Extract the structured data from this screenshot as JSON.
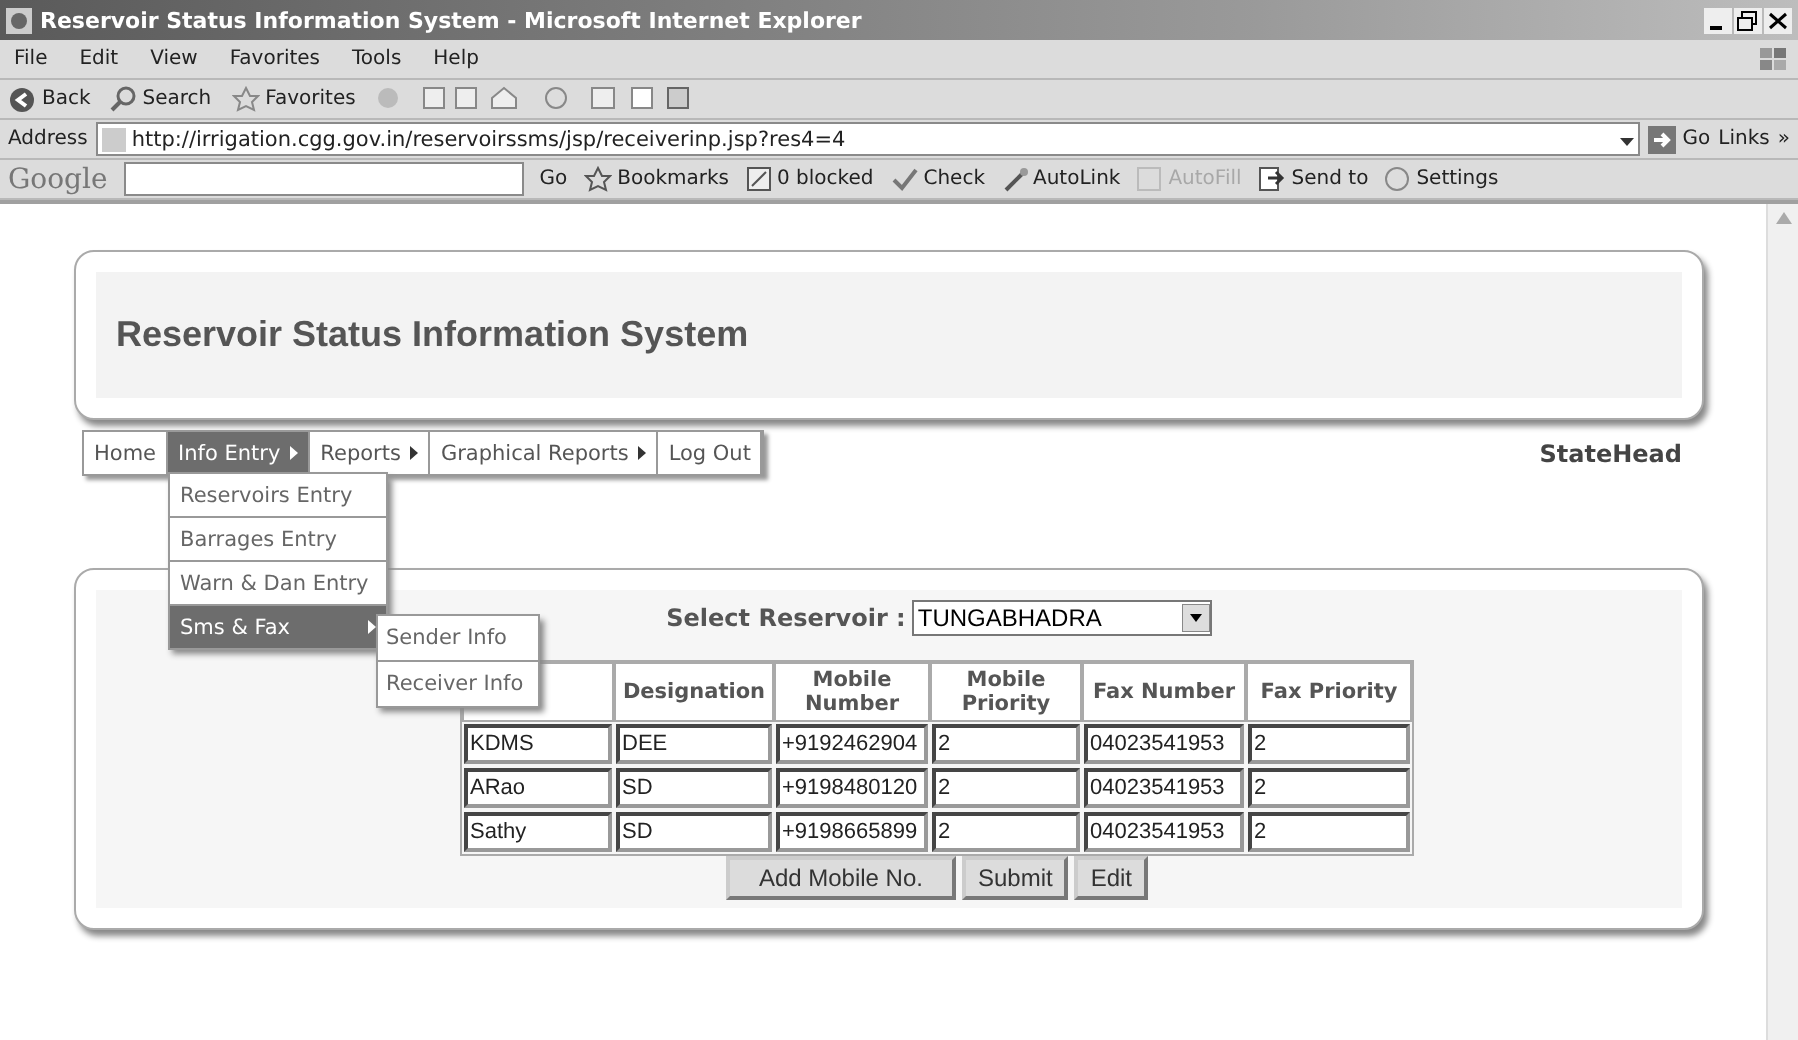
{
  "window": {
    "title": "Reservoir Status Information System - Microsoft Internet Explorer"
  },
  "menu_bar": {
    "items": [
      "File",
      "Edit",
      "View",
      "Favorites",
      "Tools",
      "Help"
    ]
  },
  "toolbar": {
    "buttons": [
      {
        "label": "Back",
        "kind": "back"
      },
      {
        "label": "Search",
        "kind": "search"
      },
      {
        "label": "Favorites",
        "kind": "favorites"
      }
    ]
  },
  "address_bar": {
    "label": "Address",
    "url": "http://irrigation.cgg.gov.in/reservoirssms/jsp/receiverinp.jsp?res4=4",
    "go": "Go",
    "links": "Links",
    "more": "»"
  },
  "google_bar": {
    "logo": "Google",
    "go": "Go",
    "items": [
      {
        "label": "Bookmarks",
        "kind": "star",
        "disabled": false
      },
      {
        "label": "0 blocked",
        "kind": "block",
        "disabled": false
      },
      {
        "label": "Check",
        "kind": "check",
        "disabled": false
      },
      {
        "label": "AutoLink",
        "kind": "wand",
        "disabled": false
      },
      {
        "label": "AutoFill",
        "kind": "form",
        "disabled": true
      },
      {
        "label": "Send to",
        "kind": "send",
        "disabled": false
      },
      {
        "label": "Settings",
        "kind": "settings",
        "disabled": false
      }
    ]
  },
  "page": {
    "title": "Reservoir Status Information System",
    "nav": [
      {
        "label": "Home",
        "has_submenu": false,
        "selected": false
      },
      {
        "label": "Info Entry",
        "has_submenu": true,
        "selected": true
      },
      {
        "label": "Reports",
        "has_submenu": true,
        "selected": false
      },
      {
        "label": "Graphical Reports",
        "has_submenu": true,
        "selected": false
      },
      {
        "label": "Log Out",
        "has_submenu": false,
        "selected": false
      }
    ],
    "user": "StateHead",
    "dropdown": [
      {
        "label": "Reservoirs Entry",
        "selected": false,
        "has_submenu": false
      },
      {
        "label": "Barrages Entry",
        "selected": false,
        "has_submenu": false
      },
      {
        "label": "Warn & Dan Entry",
        "selected": false,
        "has_submenu": false
      },
      {
        "label": "Sms & Fax",
        "selected": true,
        "has_submenu": true
      }
    ],
    "submenu": [
      "Sender Info",
      "Receiver Info"
    ],
    "select_label": "Select Reservoir :",
    "select_value": "TUNGABHADRA",
    "table": {
      "columns": [
        "",
        "Designation",
        "Mobile Number",
        "Mobile Priority",
        "Fax Number",
        "Fax Priority"
      ],
      "rows": [
        [
          "KDMS",
          "DEE",
          "+9192462904",
          "2",
          "04023541953",
          "2"
        ],
        [
          "ARao",
          "SD",
          "+9198480120",
          "2",
          "04023541953",
          "2"
        ],
        [
          "Sathy",
          "SD",
          "+9198665899",
          "2",
          "04023541953",
          "2"
        ]
      ]
    },
    "buttons": [
      "Add Mobile No.",
      "Submit",
      "Edit"
    ]
  }
}
